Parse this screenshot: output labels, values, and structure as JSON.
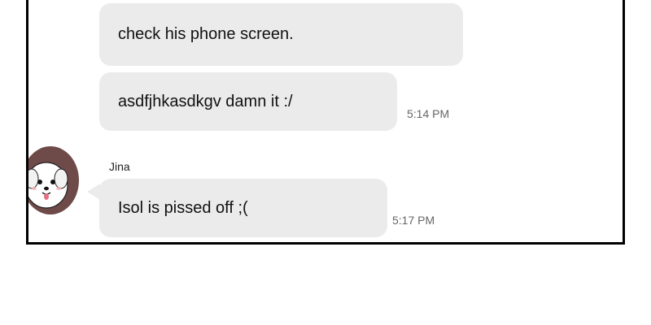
{
  "messages": [
    {
      "text": "check his phone screen."
    },
    {
      "text": "asdfjhkasdkgv damn it :/",
      "time": "5:14 PM"
    },
    {
      "sender": "Jina",
      "text": "Isol is pissed off ;(",
      "time": "5:17 PM"
    }
  ],
  "avatar": {
    "icon": "dog-avatar-icon"
  },
  "colors": {
    "bubble": "#ebebeb",
    "frame_border": "#000000",
    "timestamp": "#666666"
  }
}
